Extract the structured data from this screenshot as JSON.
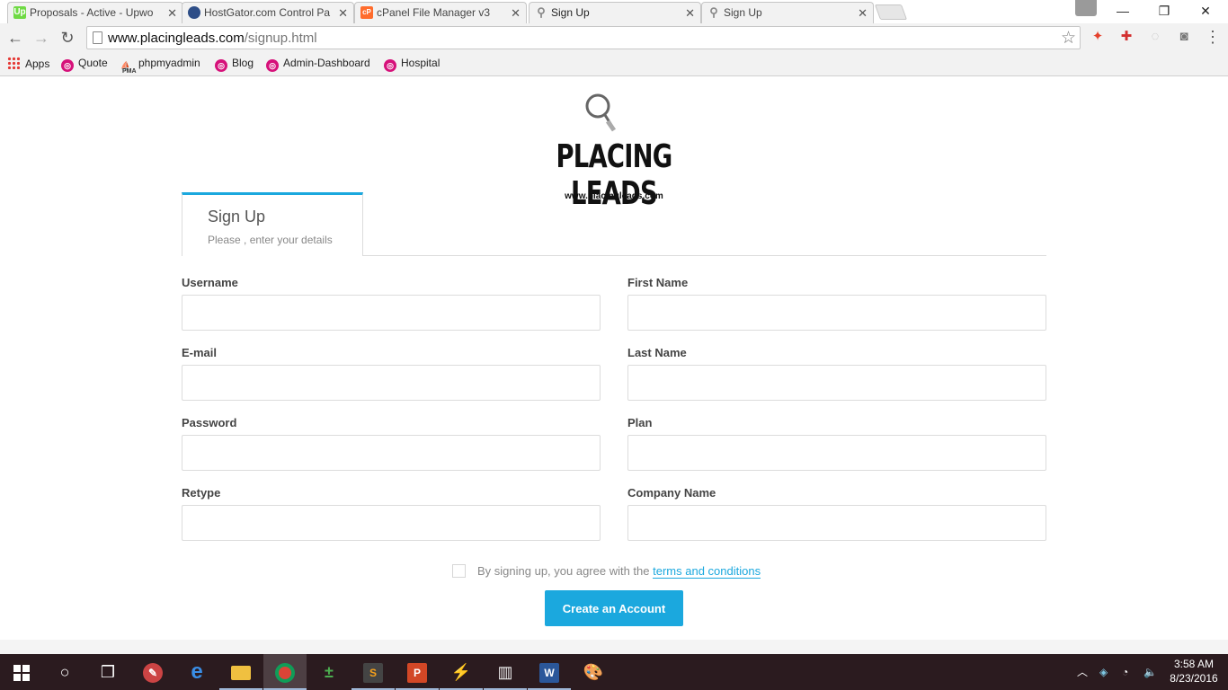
{
  "browser": {
    "tabs": [
      {
        "title": "Proposals - Active - Upwo",
        "icon": "upwork-icon",
        "color": "#6fda44",
        "icon_text": "Up"
      },
      {
        "title": "HostGator.com Control Pa",
        "icon": "hostgator-icon",
        "color": "#2e4e87",
        "icon_text": ""
      },
      {
        "title": "cPanel File Manager v3",
        "icon": "cpanel-icon",
        "color": "#ff6c2c",
        "icon_text": "cP"
      },
      {
        "title": "Sign Up",
        "icon": "page-icon",
        "color": "#999999",
        "icon_text": ""
      },
      {
        "title": "Sign Up",
        "icon": "page-icon",
        "color": "#999999",
        "icon_text": ""
      }
    ],
    "url_domain": "www.placingleads.com",
    "url_path": "/signup.html",
    "bookmarks": [
      {
        "label": "Apps"
      },
      {
        "label": "Quote"
      },
      {
        "label": "phpmyadmin"
      },
      {
        "label": "Blog"
      },
      {
        "label": "Admin-Dashboard"
      },
      {
        "label": "Hospital"
      }
    ],
    "pma_text": "PMA"
  },
  "logo": {
    "title": "PLACING LEADS",
    "subtitle": "www.placingleads.com"
  },
  "signup_tab": {
    "heading": "Sign Up",
    "subheading": "Please , enter your details"
  },
  "form": {
    "left_fields": [
      {
        "label": "Username",
        "value": ""
      },
      {
        "label": "E-mail",
        "value": ""
      },
      {
        "label": "Password",
        "value": ""
      },
      {
        "label": "Retype",
        "value": ""
      }
    ],
    "right_fields": [
      {
        "label": "First Name",
        "value": ""
      },
      {
        "label": "Last Name",
        "value": ""
      },
      {
        "label": "Plan",
        "value": ""
      },
      {
        "label": "Company Name",
        "value": ""
      }
    ],
    "terms_prefix": "By signing up, you agree with the",
    "terms_link": "terms and conditions",
    "submit_label": "Create an Account",
    "accent_color": "#1ba8de"
  },
  "taskbar": {
    "time": "3:58 AM",
    "date": "8/23/2016"
  }
}
